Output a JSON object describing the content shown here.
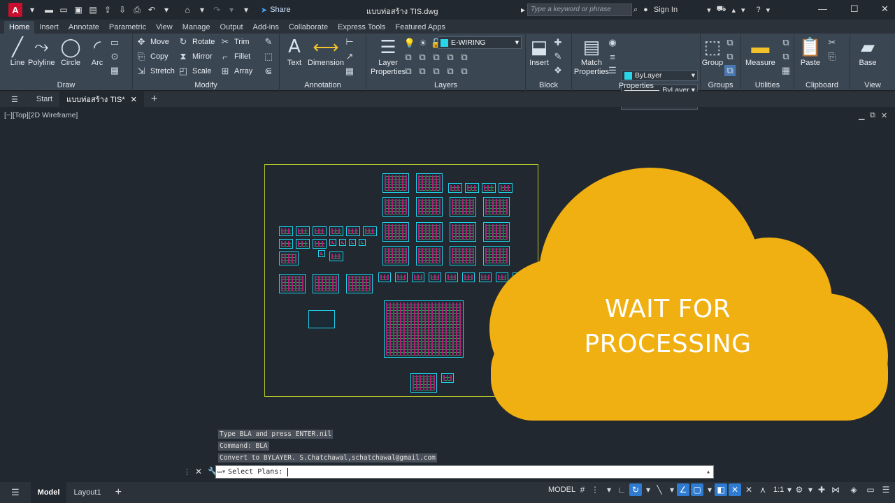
{
  "titlebar": {
    "app_logo": "A",
    "share_label": "Share",
    "doc_title": "แบบท่อสร้าง TIS.dwg",
    "search_placeholder": "Type a keyword or phrase",
    "signin_label": "Sign In"
  },
  "menu_tabs": [
    "Home",
    "Insert",
    "Annotate",
    "Parametric",
    "View",
    "Manage",
    "Output",
    "Add-ins",
    "Collaborate",
    "Express Tools",
    "Featured Apps"
  ],
  "ribbon": {
    "draw": {
      "title": "Draw",
      "line": "Line",
      "polyline": "Polyline",
      "circle": "Circle",
      "arc": "Arc"
    },
    "modify": {
      "title": "Modify",
      "move": "Move",
      "rotate": "Rotate",
      "trim": "Trim",
      "copy": "Copy",
      "mirror": "Mirror",
      "fillet": "Fillet",
      "stretch": "Stretch",
      "scale": "Scale",
      "array": "Array"
    },
    "annotation": {
      "title": "Annotation",
      "text": "Text",
      "dimension": "Dimension"
    },
    "layers": {
      "title": "Layers",
      "layer_properties": "Layer Properties",
      "current_layer": "E-WIRING"
    },
    "block": {
      "title": "Block",
      "insert": "Insert"
    },
    "properties": {
      "title": "Properties",
      "match": "Match Properties",
      "color": "ByLayer",
      "linetype": "ByLayer",
      "lineweight": "BYLAY..."
    },
    "groups": {
      "title": "Groups",
      "group": "Group"
    },
    "utilities": {
      "title": "Utilities",
      "measure": "Measure"
    },
    "clipboard": {
      "title": "Clipboard",
      "paste": "Paste"
    },
    "view": {
      "title": "View",
      "base": "Base"
    }
  },
  "file_tabs": {
    "start": "Start",
    "doc": "แบบท่อสร้าง TIS*"
  },
  "viewport_label": "[−][Top][2D Wireframe]",
  "overlay": {
    "line1": "WAIT FOR",
    "line2": "PROCESSING"
  },
  "command": {
    "history": [
      "Type BLA and press ENTER.nil",
      "Command: BLA",
      "Convert to BYLAYER. S.Chatchawal,schatchawal@gmail.com"
    ],
    "prompt": "Select Plans:"
  },
  "status": {
    "model_tab": "Model",
    "layout_tab": "Layout1",
    "mode": "MODEL",
    "scale": "1:1"
  },
  "colors": {
    "accent": "#2f7bd2",
    "cloud": "#f0b012",
    "frame": "#b5c72a",
    "sheet_border": "#1fd0e8"
  }
}
